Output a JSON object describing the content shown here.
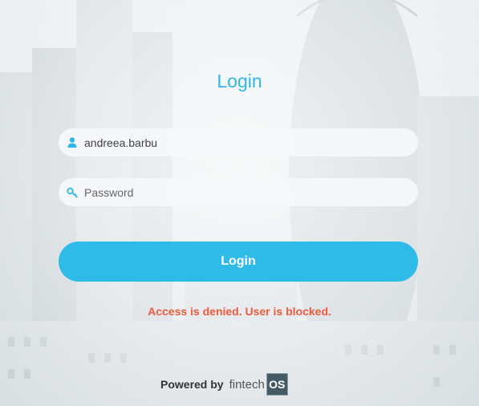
{
  "login": {
    "title": "Login",
    "username_value": "andreea.barbu",
    "password_placeholder": "Password",
    "button_label": "Login",
    "error_message": "Access is denied. User is blocked."
  },
  "footer": {
    "powered_label": "Powered by",
    "brand_name": "fintech",
    "brand_badge": "OS"
  },
  "icons": {
    "user_field": "user-icon",
    "password_field": "key-icon"
  },
  "colors": {
    "accent": "#2fbbe8",
    "error": "#f05a3a",
    "badge": "#455a64"
  }
}
